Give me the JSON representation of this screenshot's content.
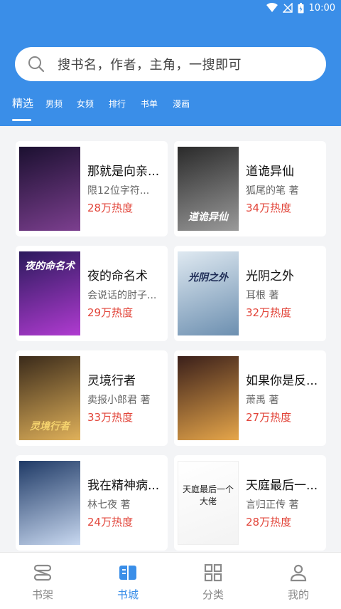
{
  "status_bar": {
    "time": "10:00"
  },
  "search": {
    "placeholder": "搜书名，作者，主角，一搜即可"
  },
  "tabs": [
    {
      "label": "精选",
      "active": true
    },
    {
      "label": "男频"
    },
    {
      "label": "女频"
    },
    {
      "label": "排行"
    },
    {
      "label": "书单"
    },
    {
      "label": "漫画"
    }
  ],
  "books": [
    {
      "title": "那就是向亲...",
      "author": "限12位字符...",
      "hot": "28万热度",
      "cover_colors": [
        "#1b1030",
        "#7c3f8f"
      ]
    },
    {
      "title": "道诡异仙",
      "author": "狐尾的笔 著",
      "hot": "34万热度",
      "cover_colors": [
        "#2a2a2a",
        "#9a9a9a"
      ],
      "cover_text": "道诡异仙"
    },
    {
      "title": "夜的命名术",
      "author": "会说话的肘子...",
      "hot": "29万热度",
      "cover_colors": [
        "#2b1a5c",
        "#b03bd1"
      ],
      "cover_text": "夜的命名术"
    },
    {
      "title": "光阴之外",
      "author": "耳根 著",
      "hot": "32万热度",
      "cover_colors": [
        "#dfe9f1",
        "#6c8fb0"
      ],
      "cover_text": "光阴之外"
    },
    {
      "title": "灵境行者",
      "author": "卖报小郎君 著",
      "hot": "33万热度",
      "cover_colors": [
        "#3a2a1a",
        "#e0b15a"
      ],
      "cover_text": "灵境行者"
    },
    {
      "title": "如果你是反...",
      "author": "萧禹 著",
      "hot": "27万热度",
      "cover_colors": [
        "#3a1f1a",
        "#e6a64a"
      ]
    },
    {
      "title": "我在精神病...",
      "author": "林七夜 著",
      "hot": "24万热度",
      "cover_colors": [
        "#1f3a66",
        "#c8d8f0"
      ]
    },
    {
      "title": "天庭最后一...",
      "author": "言归正传 著",
      "hot": "28万热度",
      "cover_colors": [
        "#ffffff",
        "#f3f3f3"
      ],
      "cover_text": "天庭最后一个大佬"
    }
  ],
  "bottom_nav": [
    {
      "label": "书架",
      "icon": "bookshelf-icon"
    },
    {
      "label": "书城",
      "icon": "book-open-icon",
      "active": true
    },
    {
      "label": "分类",
      "icon": "grid-icon"
    },
    {
      "label": "我的",
      "icon": "user-icon"
    }
  ],
  "colors": {
    "primary": "#3a8ee8",
    "hot": "#e2453a"
  }
}
